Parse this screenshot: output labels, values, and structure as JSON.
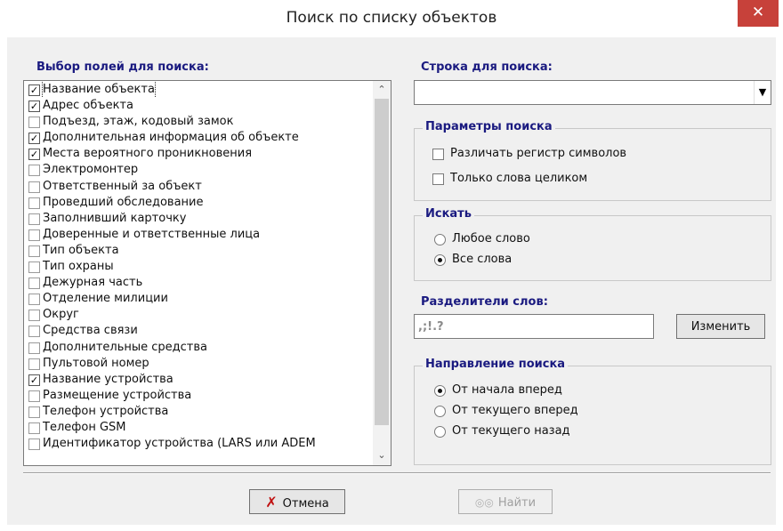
{
  "window": {
    "title": "Поиск по списку объектов",
    "close_glyph": "✕"
  },
  "fields": {
    "heading": "Выбор полей для поиска:",
    "items": [
      {
        "label": "Название объекта",
        "checked": true
      },
      {
        "label": "Адрес объекта",
        "checked": true
      },
      {
        "label": "Подъезд, этаж, кодовый замок",
        "checked": false
      },
      {
        "label": "Дополнительная информация об объекте",
        "checked": true
      },
      {
        "label": "Места вероятного проникновения",
        "checked": true
      },
      {
        "label": "Электромонтер",
        "checked": false
      },
      {
        "label": "Ответственный за объект",
        "checked": false
      },
      {
        "label": "Проведший обследование",
        "checked": false
      },
      {
        "label": "Заполнивший карточку",
        "checked": false
      },
      {
        "label": "Доверенные и ответственные лица",
        "checked": false
      },
      {
        "label": "Тип объекта",
        "checked": false
      },
      {
        "label": "Тип охраны",
        "checked": false
      },
      {
        "label": "Дежурная часть",
        "checked": false
      },
      {
        "label": "Отделение милиции",
        "checked": false
      },
      {
        "label": "Округ",
        "checked": false
      },
      {
        "label": "Средства связи",
        "checked": false
      },
      {
        "label": "Дополнительные средства",
        "checked": false
      },
      {
        "label": "Пультовой номер",
        "checked": false
      },
      {
        "label": "Название устройства",
        "checked": true
      },
      {
        "label": "Размещение устройства",
        "checked": false
      },
      {
        "label": "Телефон устройства",
        "checked": false
      },
      {
        "label": "Телефон GSM",
        "checked": false
      },
      {
        "label": "Идентификатор устройства (LARS или ADEM",
        "checked": false
      }
    ]
  },
  "search": {
    "heading": "Строка для поиска:",
    "value": ""
  },
  "params": {
    "title": "Параметры поиска",
    "case_label": "Различать регистр символов",
    "case_checked": false,
    "whole_label": "Только слова целиком",
    "whole_checked": false
  },
  "mode": {
    "title": "Искать",
    "options": [
      {
        "label": "Любое слово",
        "selected": false
      },
      {
        "label": "Все слова",
        "selected": true
      }
    ]
  },
  "separators": {
    "heading": "Разделители слов:",
    "value": ",;!.?",
    "change_label": "Изменить"
  },
  "direction": {
    "title": "Направление поиска",
    "options": [
      {
        "label": "От начала вперед",
        "selected": true
      },
      {
        "label": "От текущего вперед",
        "selected": false
      },
      {
        "label": "От текущего назад",
        "selected": false
      }
    ]
  },
  "buttons": {
    "cancel": "Отмена",
    "find": "Найти",
    "find_enabled": false
  },
  "colors": {
    "heading": "#1a1a80",
    "close": "#c7413a",
    "cancel_icon": "#c01010"
  }
}
